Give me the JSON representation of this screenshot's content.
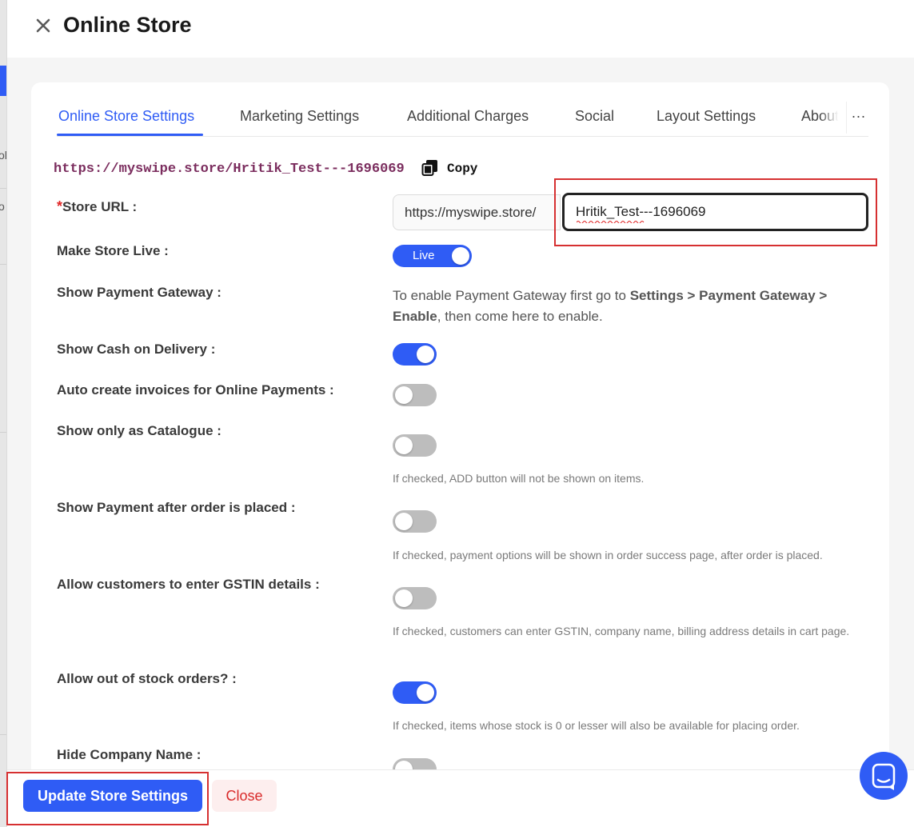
{
  "drawer": {
    "title": "Online Store"
  },
  "tabs": [
    {
      "label": "Online Store Settings"
    },
    {
      "label": "Marketing Settings"
    },
    {
      "label": "Additional Charges"
    },
    {
      "label": "Social"
    },
    {
      "label": "Layout Settings"
    },
    {
      "label": "About"
    }
  ],
  "tab_more_label": "···",
  "store_link": {
    "url": "https://myswipe.store/Hritik_Test---1696069",
    "copy_label": "Copy"
  },
  "fields": {
    "store_url": {
      "required_mark": "*",
      "label": "Store URL :",
      "prefix": "https://myswipe.store/",
      "value": "Hritik_Test---1696069"
    },
    "make_live": {
      "label": "Make Store Live :",
      "toggle_text": "Live",
      "on": true
    },
    "payment_gateway": {
      "label": "Show Payment Gateway :",
      "text_prefix": "To enable Payment Gateway first go to ",
      "text_bold_1": "Settings > Payment Gateway >",
      "text_bold_2": "Enable",
      "text_suffix": ", then come here to enable."
    },
    "cash_on_delivery": {
      "label": "Show Cash on Delivery :",
      "on": true
    },
    "auto_invoices": {
      "label": "Auto create invoices for Online Payments :",
      "on": false
    },
    "catalogue": {
      "label": "Show only as Catalogue :",
      "on": false,
      "hint": "If checked, ADD button will not be shown on items."
    },
    "payment_after_order": {
      "label": "Show Payment after order is placed :",
      "on": false,
      "hint": "If checked, payment options will be shown in order success page, after order is placed."
    },
    "gstin": {
      "label": "Allow customers to enter GSTIN details :",
      "on": false,
      "hint": "If checked, customers can enter GSTIN, company name, billing address details in cart page."
    },
    "out_of_stock": {
      "label": "Allow out of stock orders? :",
      "on": true,
      "hint": "If checked, items whose stock is 0 or lesser will also be available for placing order."
    },
    "hide_company": {
      "label": "Hide Company Name :",
      "on": false
    }
  },
  "footer": {
    "update_label": "Update Store Settings",
    "close_label": "Close"
  },
  "side_strip": {
    "text_1": "ol",
    "text_2": "o"
  },
  "colors": {
    "accent": "#2f5cf5",
    "link": "#7b2d5e",
    "danger": "#d92b2b",
    "highlight": "#d63031"
  }
}
